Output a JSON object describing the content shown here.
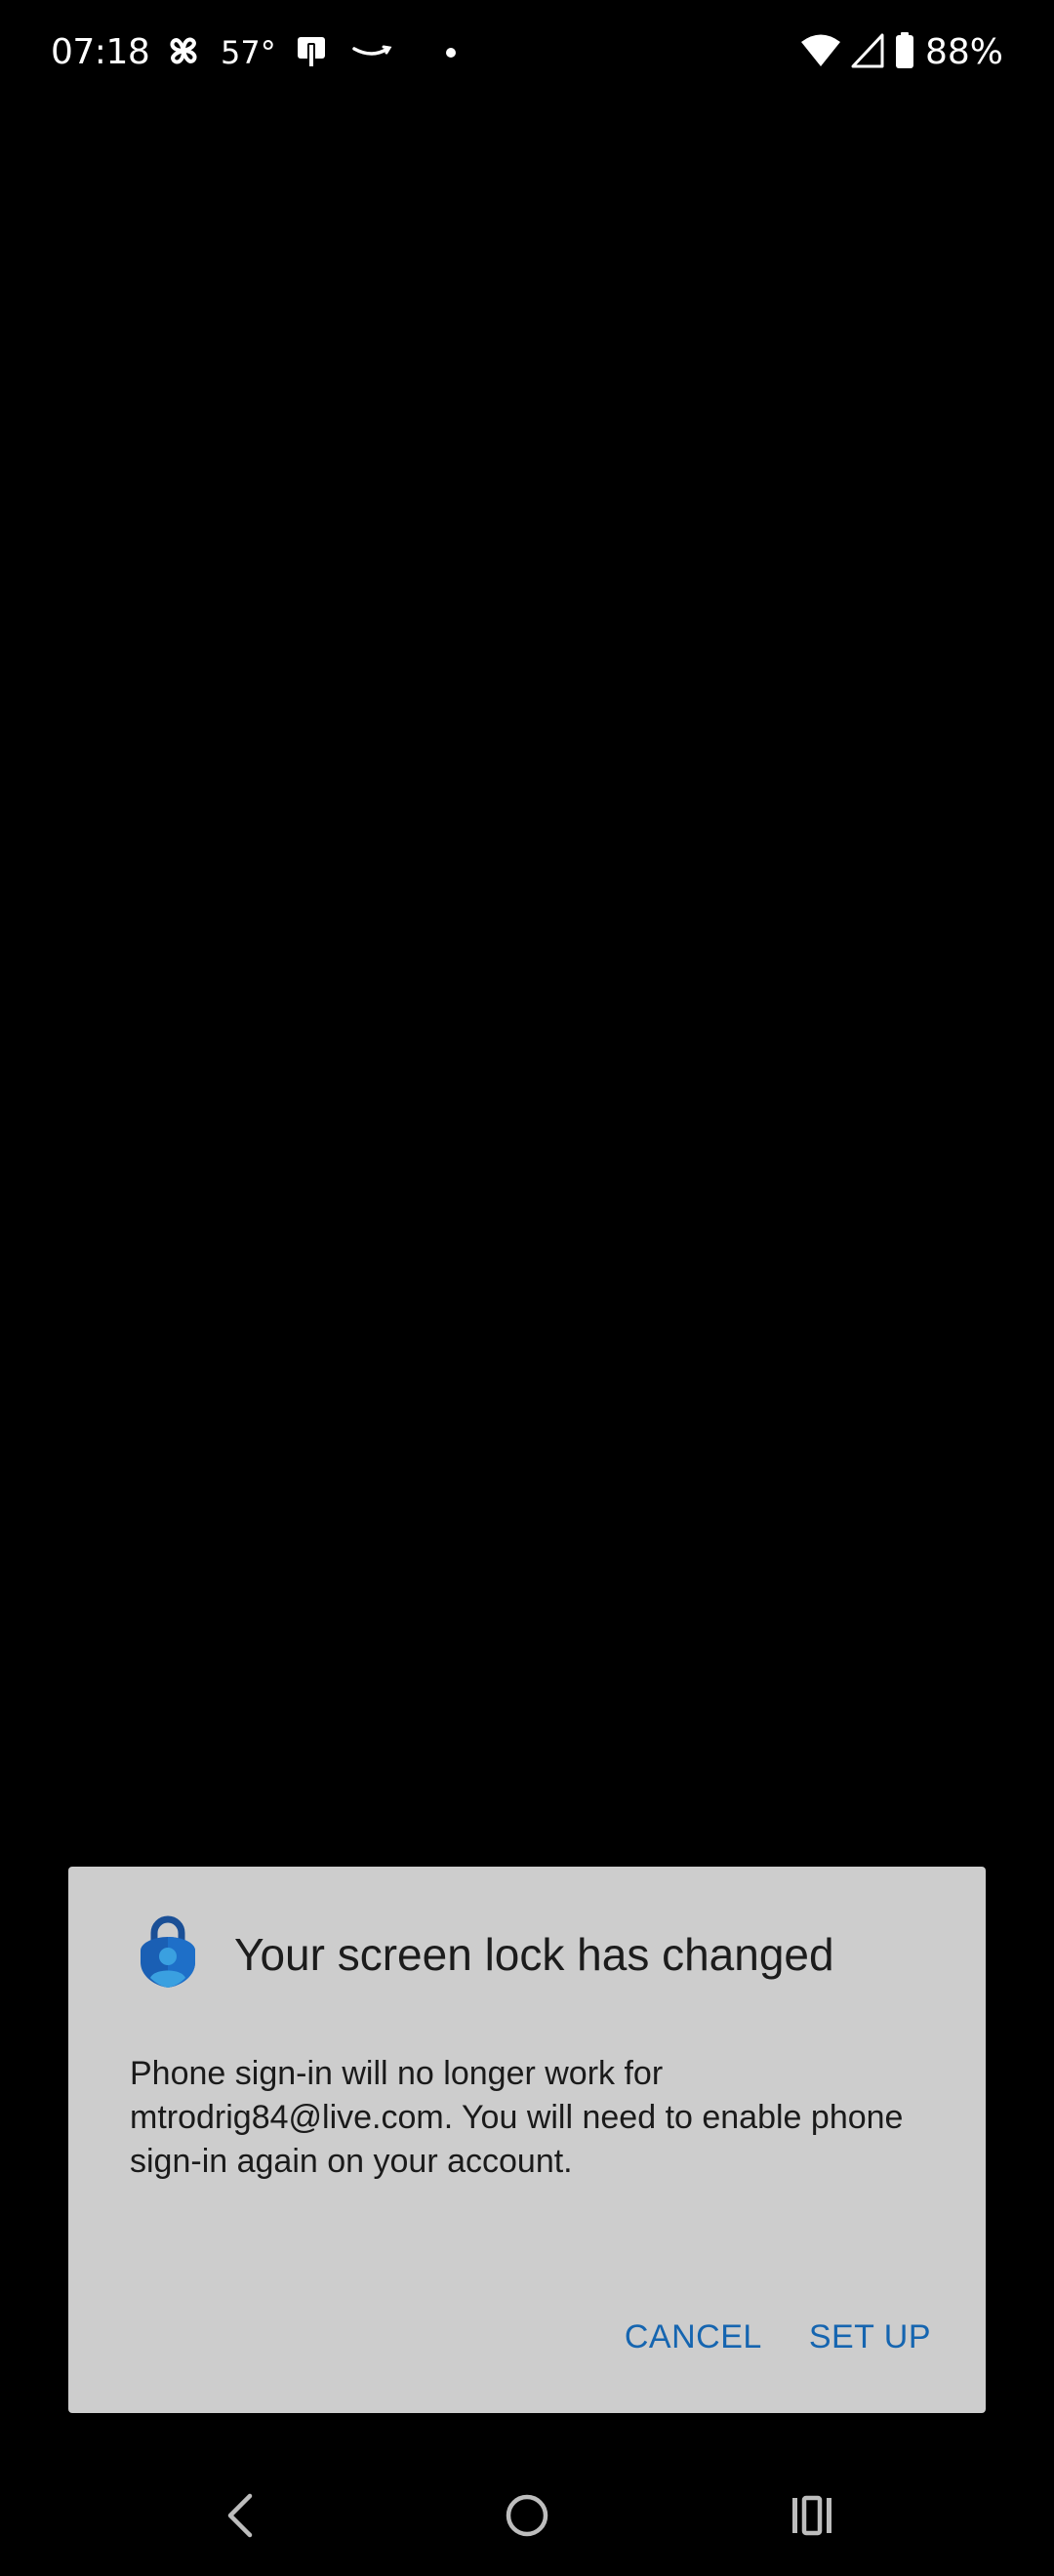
{
  "status_bar": {
    "time": "07:18",
    "temperature": "57°",
    "battery": "88%"
  },
  "dialog": {
    "title": "Your screen lock has changed",
    "message": "Phone sign-in will no longer work for mtrodrig84@live.com. You will need to enable phone sign-in again on your account.",
    "cancel_label": "CANCEL",
    "setup_label": "SET UP",
    "accent_color": "#1565b0",
    "background_color": "#cdcdcd"
  },
  "icons": {
    "app": "authenticator-lock-icon",
    "back": "back-icon",
    "home": "home-icon",
    "recents": "recents-icon"
  }
}
